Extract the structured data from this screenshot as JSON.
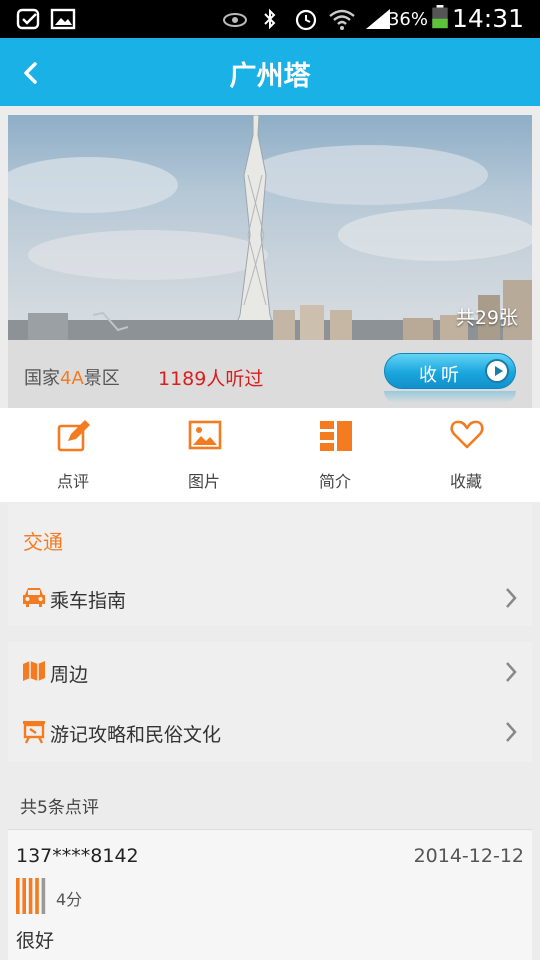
{
  "status_bar": {
    "battery": "36%",
    "time": "14:31",
    "icons": [
      "bird-icon",
      "image-icon",
      "eye-icon",
      "bluetooth-icon",
      "alarm-icon",
      "wifi-icon",
      "signal-icon",
      "battery-icon"
    ]
  },
  "header": {
    "title": "广州塔",
    "back_icon": "chevron-left-icon"
  },
  "hero": {
    "photo_count": "共29张"
  },
  "info_bar": {
    "grade_prefix": "国家",
    "grade_level": "4A",
    "grade_suffix": "景区",
    "listen_count": "1189人听过",
    "listen_button": "收听"
  },
  "actions": [
    {
      "label": "点评",
      "icon": "edit-icon"
    },
    {
      "label": "图片",
      "icon": "image-icon"
    },
    {
      "label": "简介",
      "icon": "columns-icon"
    },
    {
      "label": "收藏",
      "icon": "heart-icon"
    }
  ],
  "transport": {
    "title": "交通",
    "items": [
      {
        "label": "乘车指南",
        "icon": "car-icon"
      }
    ]
  },
  "explore": {
    "items": [
      {
        "label": "周边",
        "icon": "map-icon"
      },
      {
        "label": "游记攻略和民俗文化",
        "icon": "billboard-icon"
      }
    ]
  },
  "reviews": {
    "header": "共5条点评",
    "items": [
      {
        "user": "137****8142",
        "date": "2014-12-12",
        "score": "4分",
        "text": "很好",
        "rating_fraction": 0.8
      }
    ]
  },
  "colors": {
    "accent": "#f47b20",
    "titlebar": "#1ab1e6",
    "highlight_red": "#d91e1e"
  }
}
